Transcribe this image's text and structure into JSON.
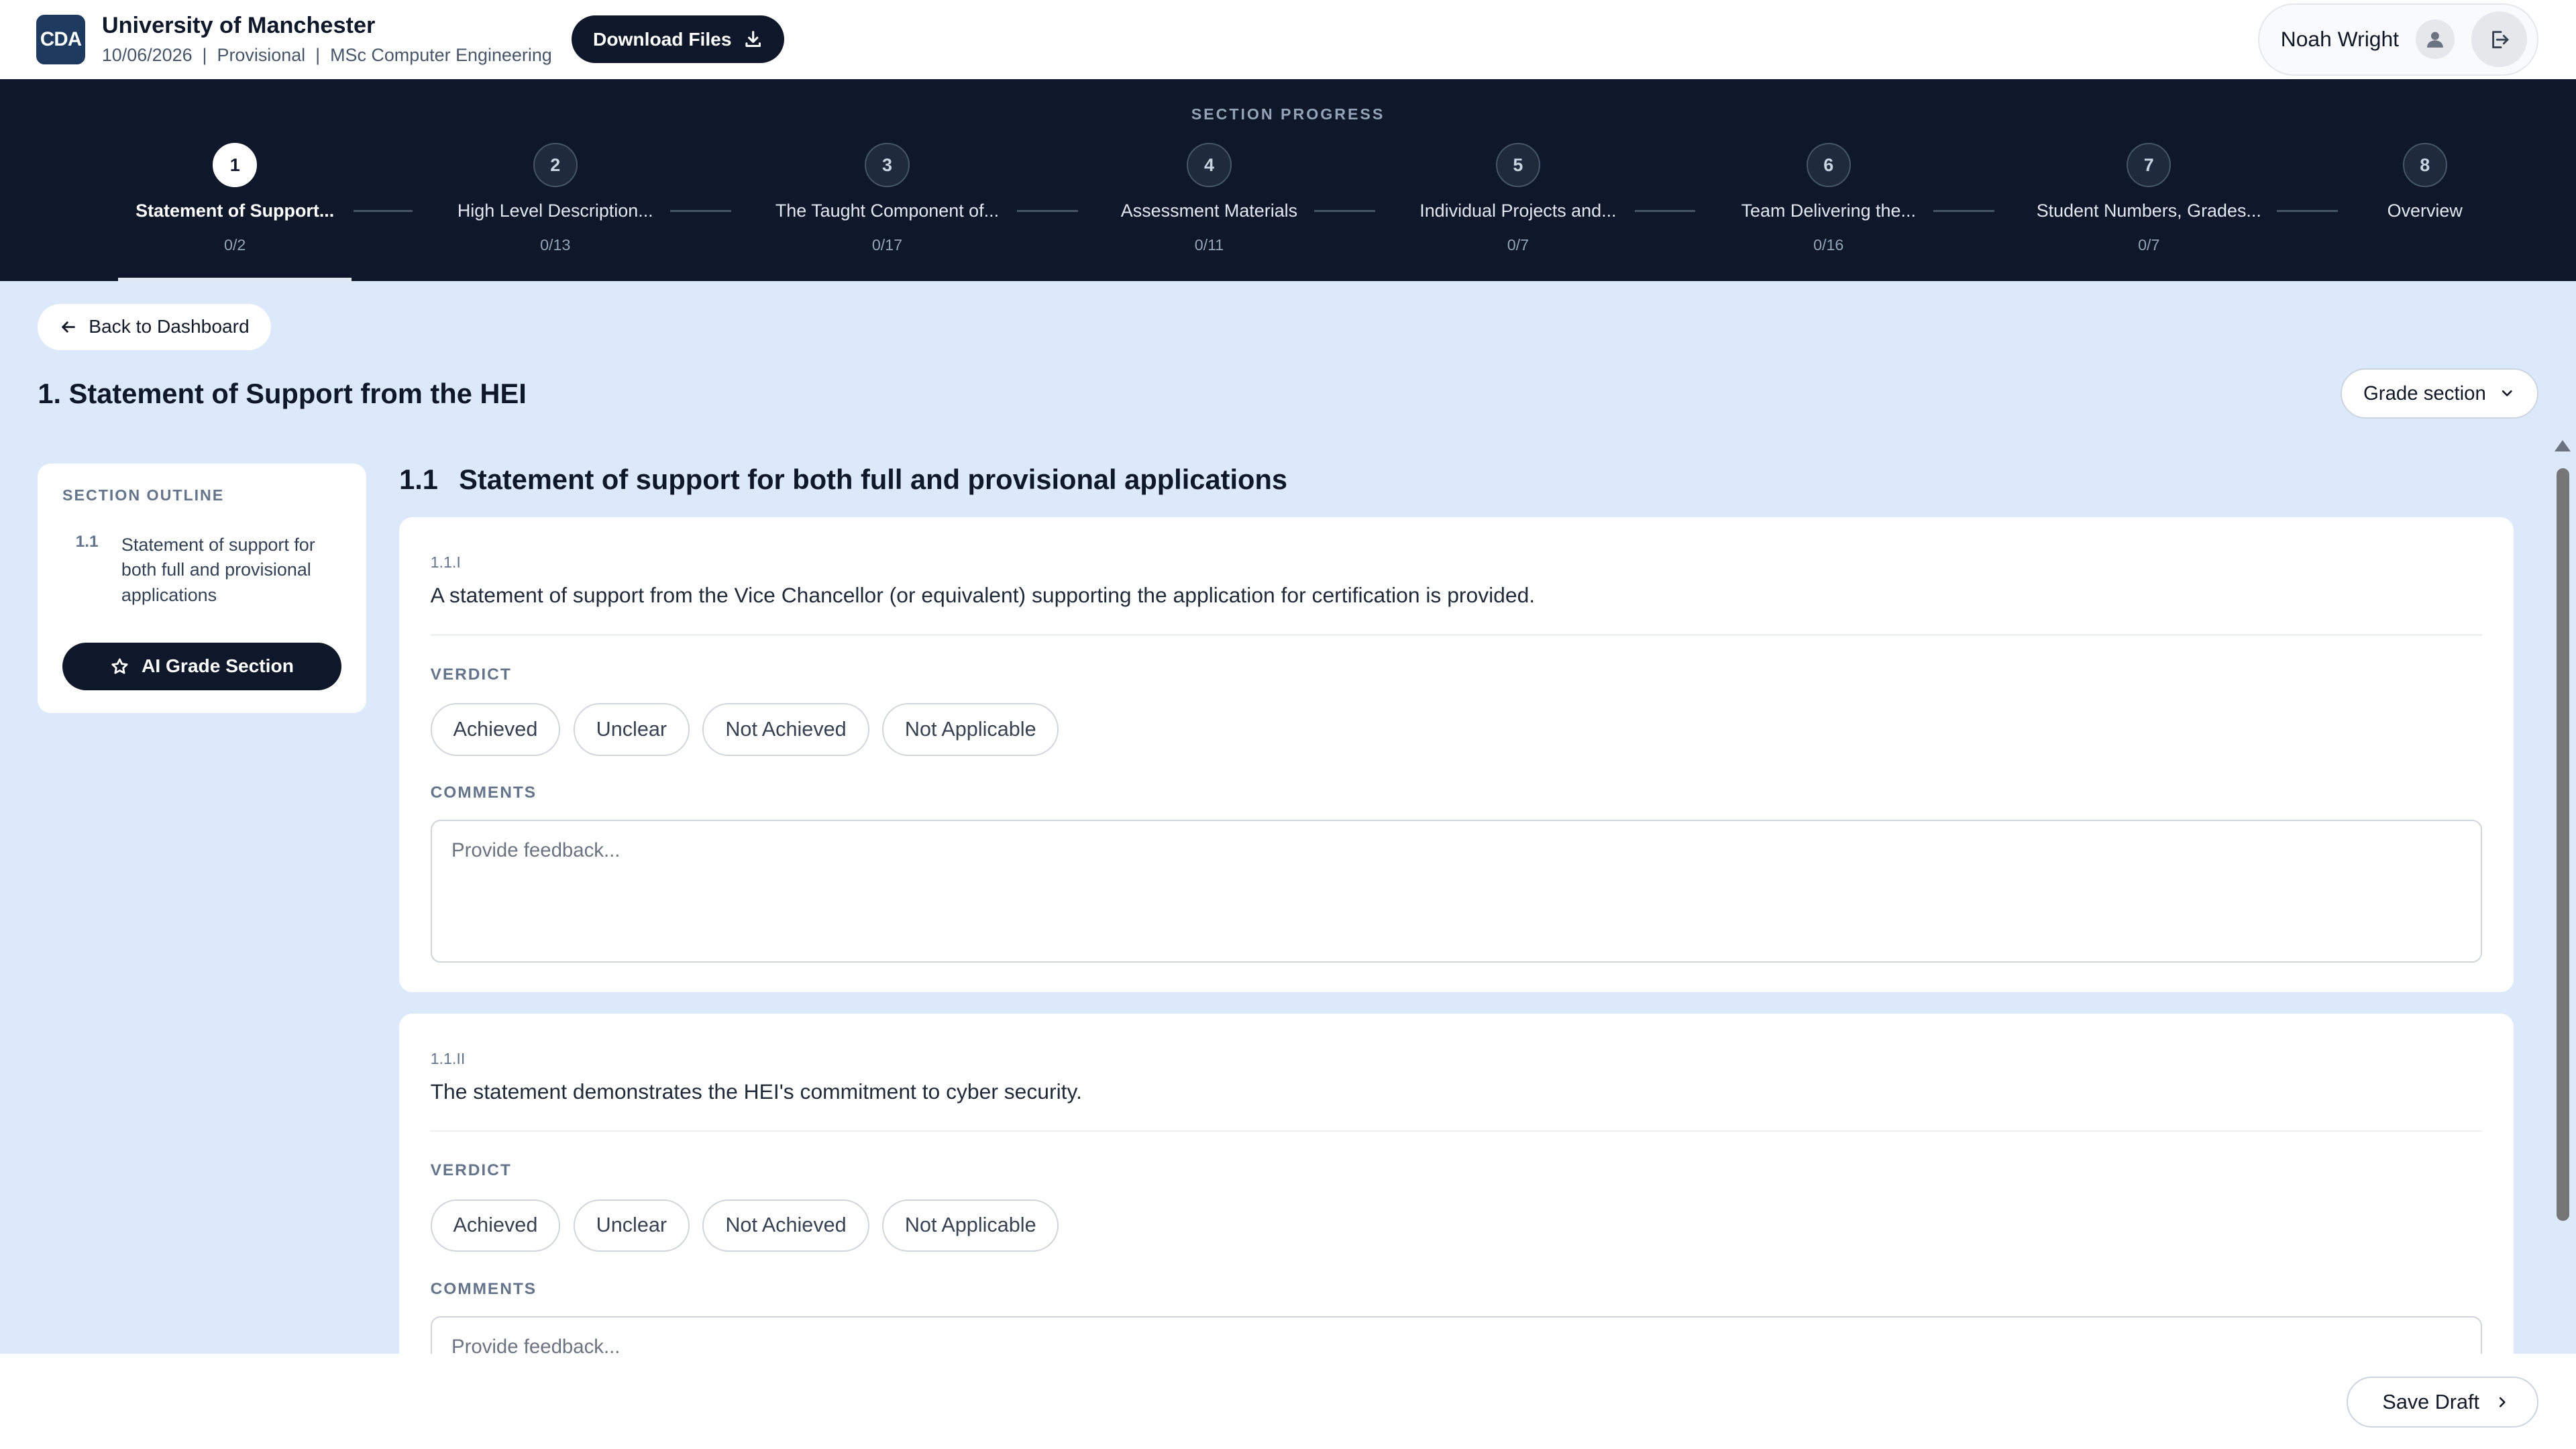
{
  "header": {
    "logo_text": "CDA",
    "org_name": "University of Manchester",
    "meta": "10/06/2026  |  Provisional  |  MSc Computer Engineering",
    "download_label": "Download Files",
    "user_name": "Noah Wright"
  },
  "progress": {
    "title": "SECTION PROGRESS",
    "steps": [
      {
        "num": "1",
        "label": "Statement of Support...",
        "count": "0/2"
      },
      {
        "num": "2",
        "label": "High Level Description...",
        "count": "0/13"
      },
      {
        "num": "3",
        "label": "The Taught Component of...",
        "count": "0/17"
      },
      {
        "num": "4",
        "label": "Assessment Materials",
        "count": "0/11"
      },
      {
        "num": "5",
        "label": "Individual Projects and...",
        "count": "0/7"
      },
      {
        "num": "6",
        "label": "Team Delivering the...",
        "count": "0/16"
      },
      {
        "num": "7",
        "label": "Student Numbers, Grades...",
        "count": "0/7"
      },
      {
        "num": "8",
        "label": "Overview",
        "count": ""
      }
    ]
  },
  "content": {
    "back_label": "Back to Dashboard",
    "section_title": "1. Statement of Support from the HEI",
    "grade_label": "Grade section",
    "outline": {
      "title": "SECTION OUTLINE",
      "items": [
        {
          "num": "1.1",
          "text": "Statement of support for both full and provisional applications"
        }
      ],
      "ai_button": "AI Grade Section"
    },
    "subsection": {
      "num": "1.1",
      "title": "Statement of support for both full and provisional applications"
    },
    "verdict_label": "VERDICT",
    "comments_label": "COMMENTS",
    "verdict_options": [
      "Achieved",
      "Unclear",
      "Not Achieved",
      "Not Applicable"
    ],
    "comment_placeholder": "Provide feedback...",
    "criteria": [
      {
        "id": "1.1.I",
        "text": "A statement of support from the Vice Chancellor (or equivalent) supporting the application for certification is provided."
      },
      {
        "id": "1.1.II",
        "text": "The statement demonstrates the HEI's commitment to cyber security."
      }
    ]
  },
  "footer": {
    "save_label": "Save Draft"
  },
  "colors": {
    "navy": "#0f172a",
    "page_bg": "#dce9fb",
    "logo_bg": "#1e3a5f"
  }
}
